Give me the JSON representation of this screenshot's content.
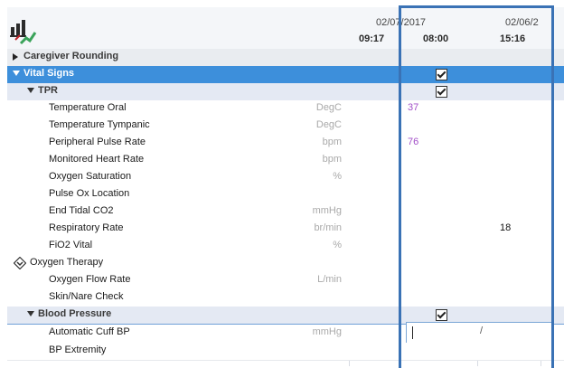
{
  "header": {
    "dates": [
      "02/07/2017",
      "02/06/2"
    ],
    "times": [
      "09:17",
      "08:00",
      "15:16"
    ]
  },
  "sections": [
    {
      "label": "Caregiver Rounding"
    },
    {
      "label": "Vital Signs"
    },
    {
      "label": "TPR"
    },
    {
      "label": "Blood Pressure"
    }
  ],
  "rows": [
    {
      "label": "Temperature Oral",
      "unit": "DegC",
      "value": "37"
    },
    {
      "label": "Temperature Tympanic",
      "unit": "DegC",
      "value": ""
    },
    {
      "label": "Peripheral Pulse Rate",
      "unit": "bpm",
      "value": "76"
    },
    {
      "label": "Monitored Heart Rate",
      "unit": "bpm",
      "value": ""
    },
    {
      "label": "Oxygen Saturation",
      "unit": "%",
      "value": ""
    },
    {
      "label": "Pulse Ox Location",
      "unit": "",
      "value": ""
    },
    {
      "label": "End Tidal CO2",
      "unit": "mmHg",
      "value": ""
    },
    {
      "label": "Respiratory Rate",
      "unit": "br/min",
      "value": "18"
    },
    {
      "label": "FiO2 Vital",
      "unit": "%",
      "value": ""
    },
    {
      "label": "Oxygen Therapy",
      "unit": "",
      "value": ""
    },
    {
      "label": "Oxygen Flow Rate",
      "unit": "L/min",
      "value": ""
    },
    {
      "label": "Skin/Nare Check",
      "unit": "",
      "value": ""
    },
    {
      "label": "Automatic Cuff BP",
      "unit": "mmHg",
      "value": "/"
    },
    {
      "label": "BP Extremity",
      "unit": "",
      "value": ""
    }
  ],
  "colors": {
    "selected_row": "#3d8fdb",
    "value_text": "#a24fc8",
    "highlight_border": "#3a72b5"
  }
}
